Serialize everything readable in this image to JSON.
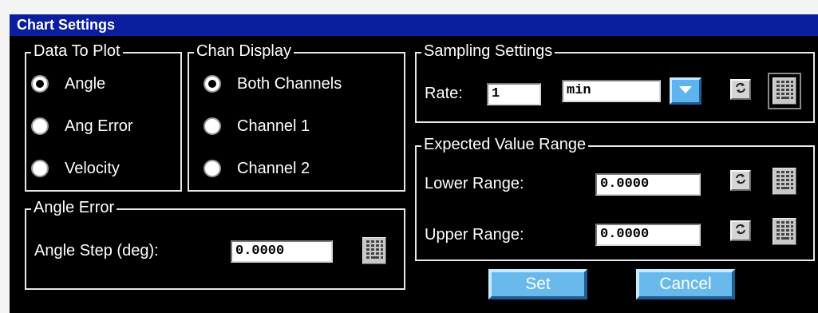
{
  "window": {
    "title": "Chart Settings"
  },
  "data_to_plot": {
    "legend": "Data To Plot",
    "options": [
      {
        "label": "Angle",
        "checked": true
      },
      {
        "label": "Ang Error",
        "checked": false
      },
      {
        "label": "Velocity",
        "checked": false
      }
    ]
  },
  "chan_display": {
    "legend": "Chan Display",
    "options": [
      {
        "label": "Both Channels",
        "checked": true
      },
      {
        "label": "Channel 1",
        "checked": false
      },
      {
        "label": "Channel 2",
        "checked": false
      }
    ]
  },
  "angle_error": {
    "legend": "Angle Error",
    "step_label": "Angle Step (deg):",
    "step_value": "0.0000"
  },
  "sampling": {
    "legend": "Sampling Settings",
    "rate_label": "Rate:",
    "rate_value": "1",
    "unit_value": "min"
  },
  "expected_range": {
    "legend": "Expected Value Range",
    "lower_label": "Lower Range:",
    "lower_value": "0.0000",
    "upper_label": "Upper Range:",
    "upper_value": "0.0000"
  },
  "buttons": {
    "set": "Set",
    "cancel": "Cancel"
  },
  "colors": {
    "title_bar": "#0b1e9e",
    "button": "#69b9ec",
    "background": "#000000"
  },
  "icons": {
    "refresh": "refresh-icon",
    "keypad": "keypad-icon",
    "dropdown": "chevron-down-icon"
  }
}
